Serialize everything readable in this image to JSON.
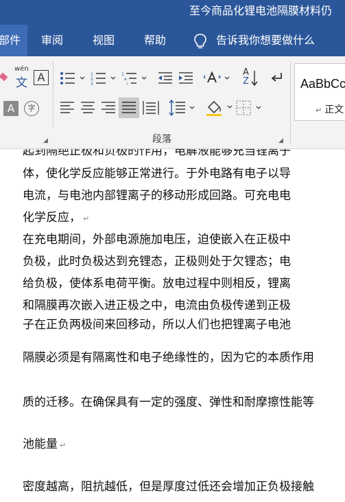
{
  "window": {
    "title": "至今商品化锂电池隔膜材料仍"
  },
  "tabs": [
    {
      "label": "部件",
      "active": true
    },
    {
      "label": "审阅"
    },
    {
      "label": "视图"
    },
    {
      "label": "帮助"
    }
  ],
  "tell_me": {
    "label": "告诉我你想要做什么"
  },
  "ribbon": {
    "phonetic_guide_label": "wén",
    "phonetic_guide_char": "文",
    "char_border_label": "A",
    "shading_label": "A",
    "enclose_char_label": "字",
    "sort_label_top": "A",
    "sort_label_bottom": "Z",
    "group_label": "段落",
    "styles": {
      "preview": "AaBbCcI",
      "name": "正文"
    }
  },
  "document": {
    "lines": [
      "起到隔绝正极和负极的作用，电解液能够充当锂离子",
      "体，使化学反应能够正常进行。于外电路有电子以导",
      "电流，与电池内部锂离子的移动形成回路。可充电电",
      "化学反应，",
      "在充电期间，外部电源施加电压，迫使嵌入在正极中",
      "负极，此时负极达到充锂态，正极则处于欠锂态；电",
      "给负极，使体系电荷平衡。放电过程中则相反，锂离",
      "和隔膜再次嵌入进正极之中，电流由负极传递到正极",
      "子在正负两极间来回移动，所以人们也把锂离子电池",
      "隔膜必须是有隔离性和电子绝缘性的，因为它的本质作用",
      "质的迁移。在确保具有一定的强度、弹性和耐摩擦性能等",
      "池能量",
      "密度越高，阻抗越低，但是厚度过低还会增加正负极接触"
    ],
    "paragraph_mark": "↵"
  },
  "colors": {
    "ribbon_blue": "#2b579a",
    "active_tab": "#3d6cb5",
    "ribbon_bg": "#f3f3f3",
    "squiggle": "#d00000"
  }
}
